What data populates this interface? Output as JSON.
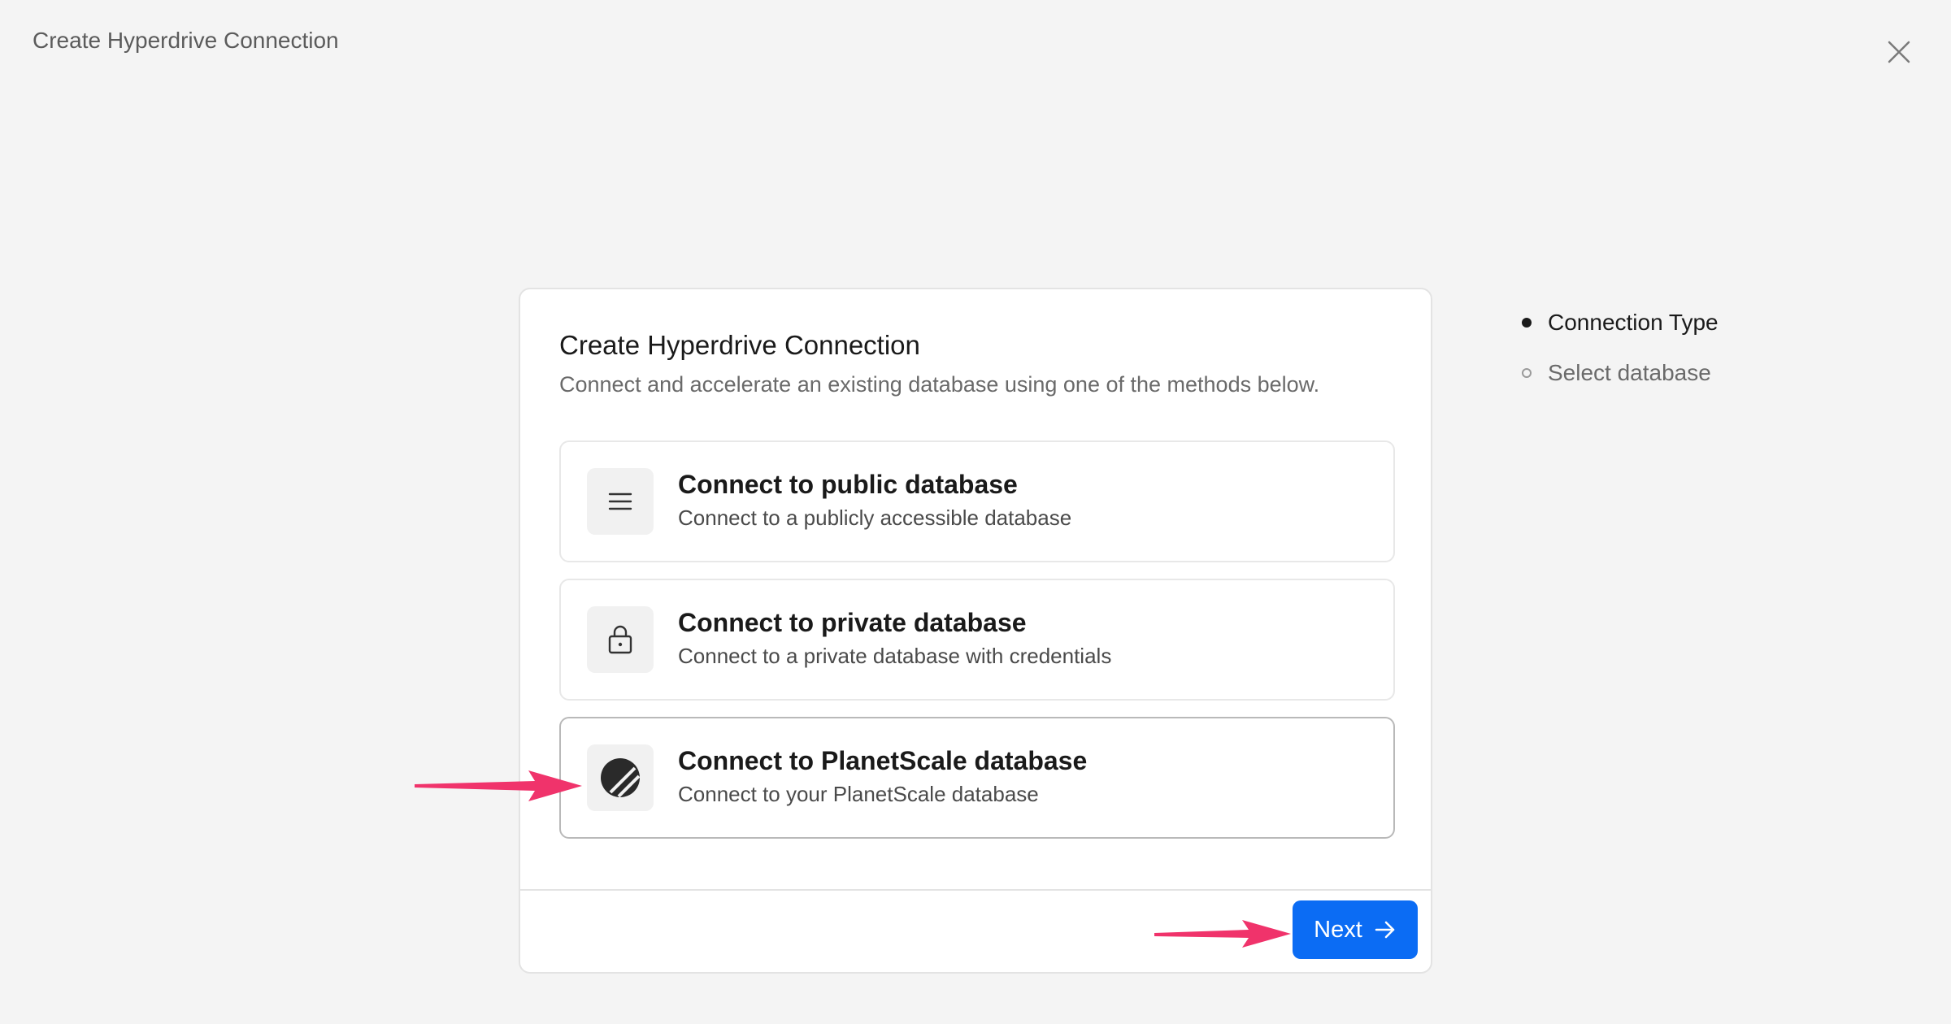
{
  "header": {
    "title": "Create Hyperdrive Connection",
    "close_icon": "close-icon"
  },
  "card": {
    "title": "Create Hyperdrive Connection",
    "description": "Connect and accelerate an existing database using one of the methods below.",
    "options": [
      {
        "title": "Connect to public database",
        "description": "Connect to a publicly accessible database",
        "icon": "list-icon",
        "selected": false
      },
      {
        "title": "Connect to private database",
        "description": "Connect to a private database with credentials",
        "icon": "lock-icon",
        "selected": false
      },
      {
        "title": "Connect to PlanetScale database",
        "description": "Connect to your PlanetScale database",
        "icon": "planetscale-icon",
        "selected": true
      }
    ],
    "next_label": "Next"
  },
  "steps": [
    {
      "label": "Connection Type",
      "active": true
    },
    {
      "label": "Select database",
      "active": false
    }
  ],
  "colors": {
    "accent": "#0b6cf4",
    "annotation_arrow": "#f0336b"
  }
}
